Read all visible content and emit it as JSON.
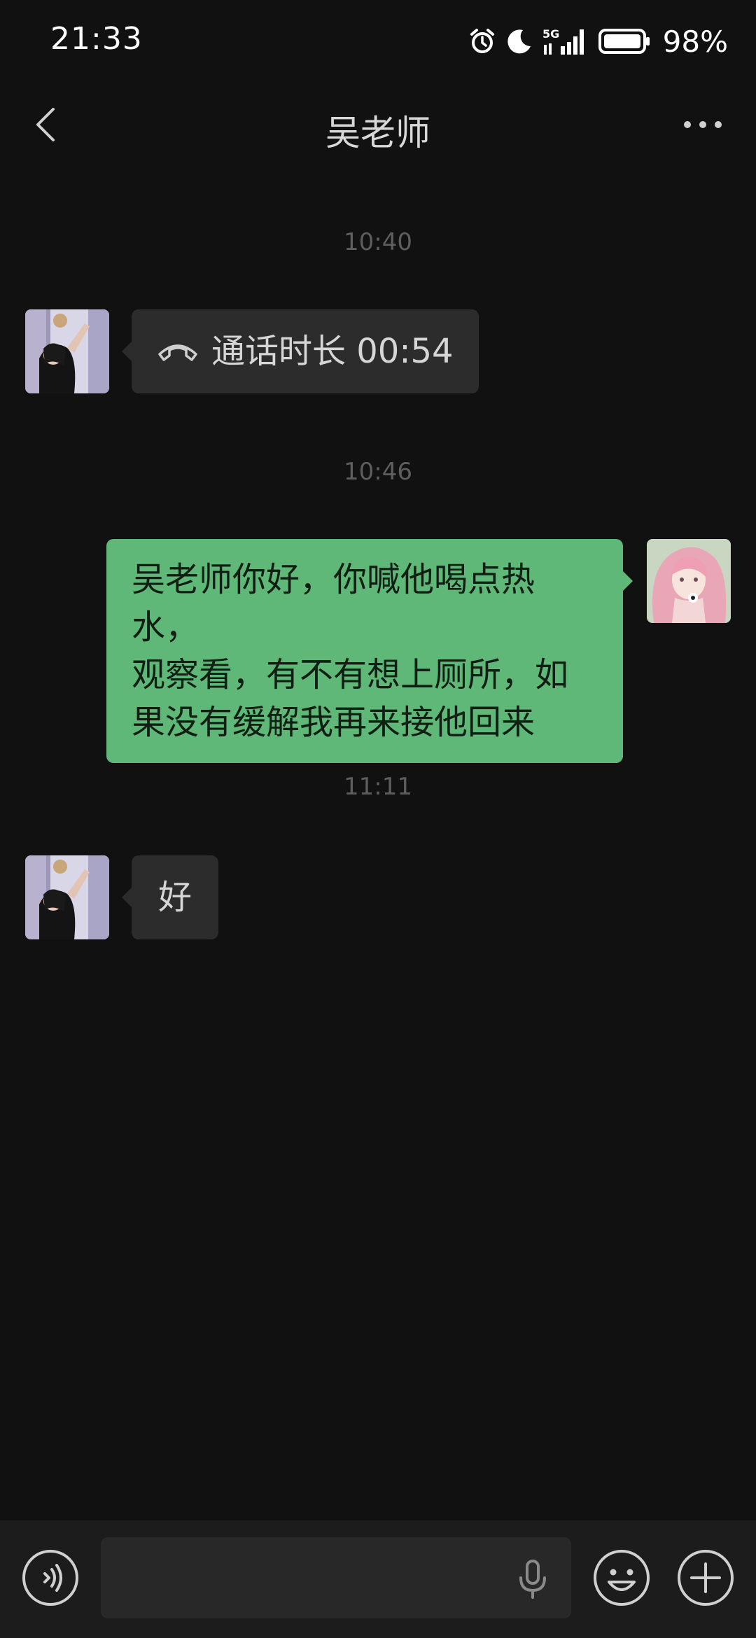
{
  "status_bar": {
    "time": "21:33",
    "network": "5G",
    "battery": "98%",
    "icons": [
      "alarm-icon",
      "moon-icon",
      "signal-5g-icon",
      "battery-icon"
    ]
  },
  "header": {
    "title": "吴老师",
    "back_icon": "chevron-left-icon",
    "more_icon": "more-dots-icon"
  },
  "messages": [
    {
      "timestamp": "10:40"
    },
    {
      "sender": "contact",
      "type": "call",
      "text": "通话时长 00:54",
      "icon": "phone-hangup-icon"
    },
    {
      "timestamp": "10:46"
    },
    {
      "sender": "me",
      "type": "text",
      "lines": [
        "吴老师你好，你喊他喝点热水，",
        "观察看，有不有想上厕所，如",
        "果没有缓解我再来接他回来"
      ]
    },
    {
      "timestamp": "11:11"
    },
    {
      "sender": "contact",
      "type": "text",
      "text": "好"
    }
  ],
  "input_bar": {
    "placeholder": "",
    "voice_icon": "voice-mode-icon",
    "mic_icon": "microphone-icon",
    "emoji_icon": "emoji-icon",
    "plus_icon": "plus-icon"
  },
  "colors": {
    "background": "#111111",
    "incoming_bubble": "#2c2c2c",
    "outgoing_bubble": "#5fb878",
    "input_bar": "#1c1c1c"
  }
}
